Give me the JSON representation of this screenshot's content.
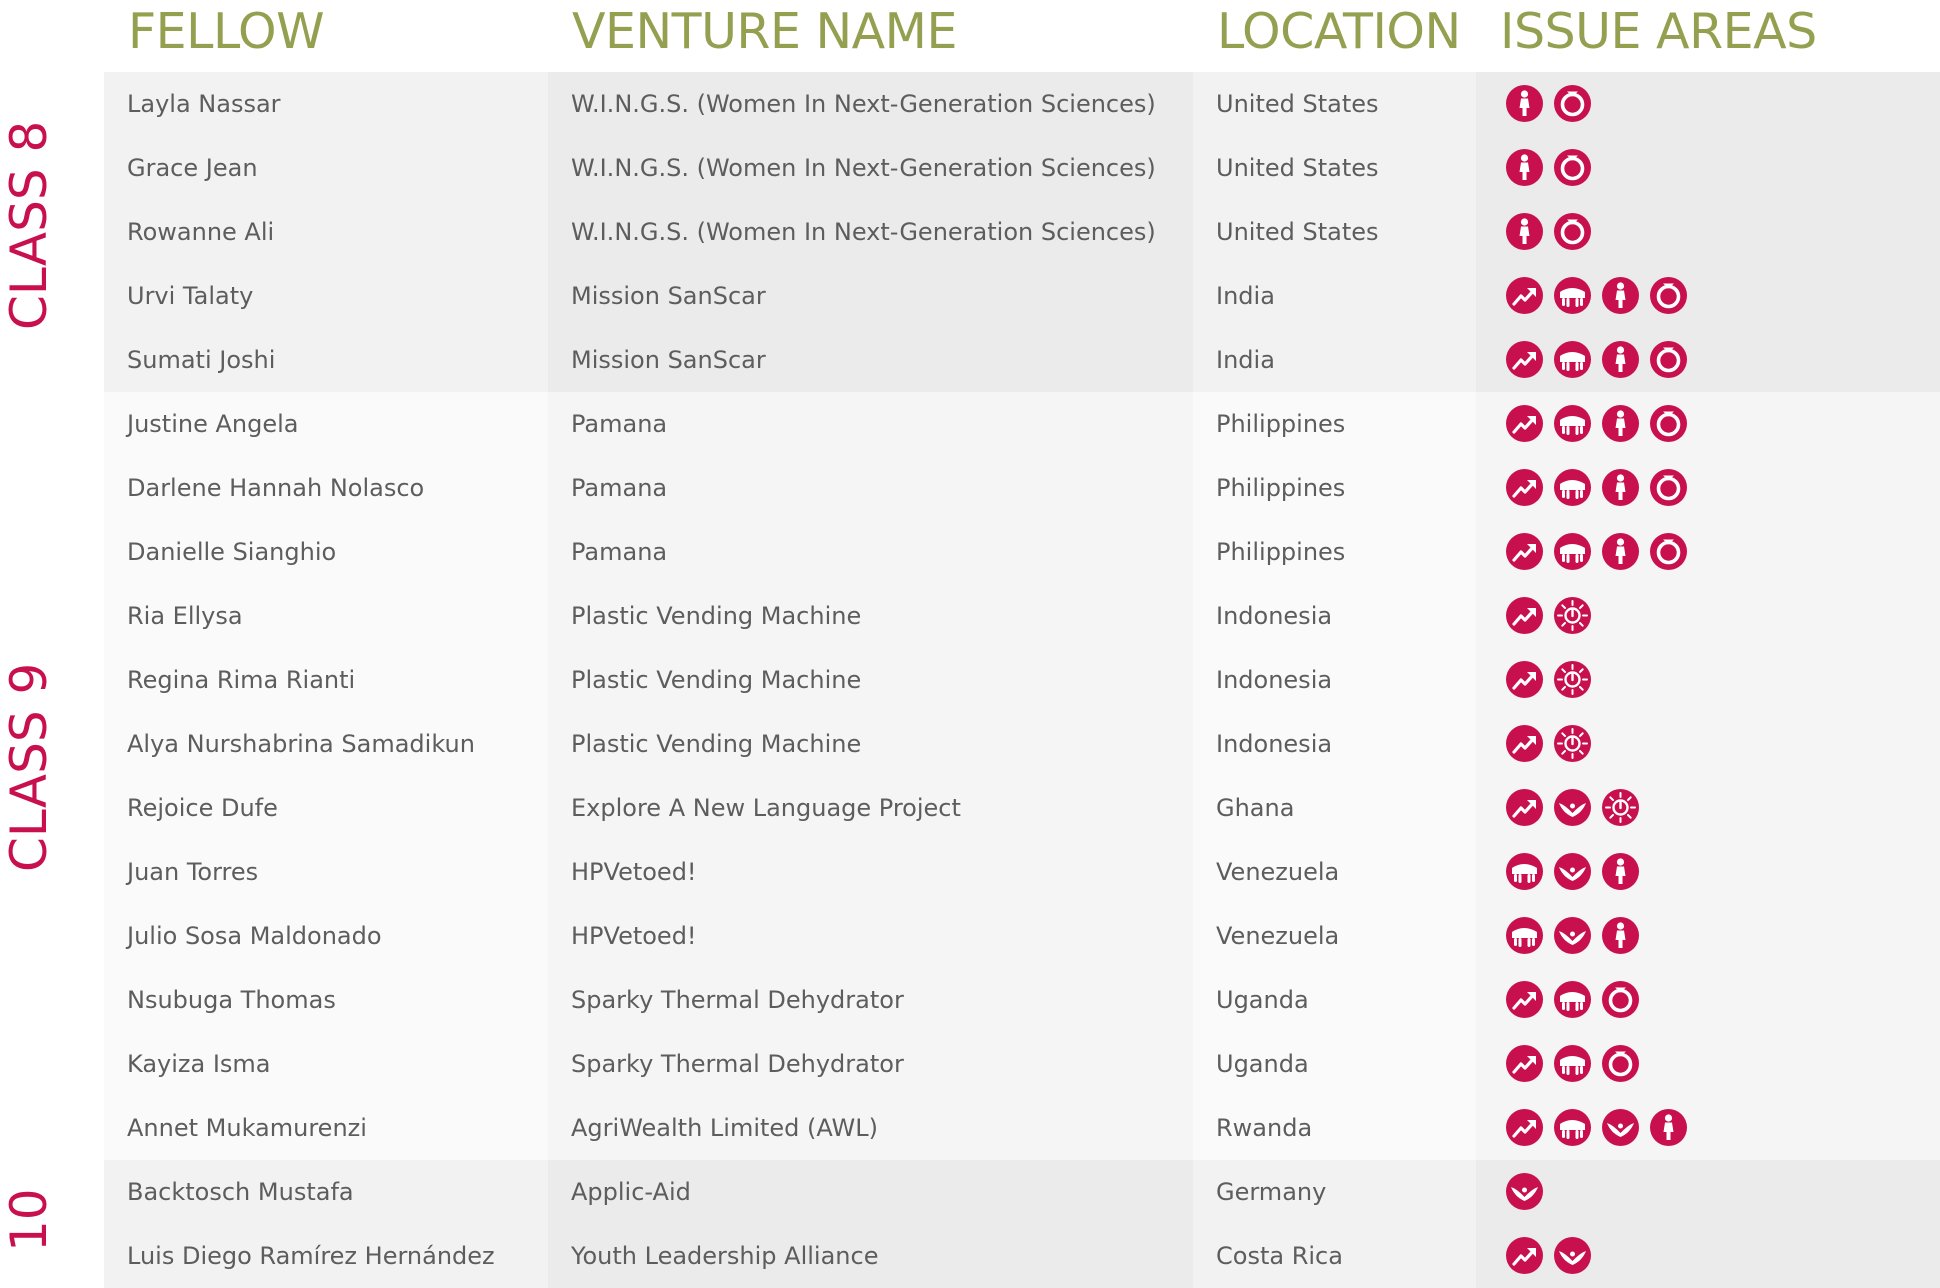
{
  "headers": {
    "fellow": "FELLOW",
    "venture": "VENTURE NAME",
    "location": "LOCATION",
    "issues": "ISSUE AREAS"
  },
  "class_labels": {
    "class8": "CLASS 8",
    "class9": "CLASS 9",
    "class10": "10"
  },
  "colors": {
    "header_text": "#94a04f",
    "class_label": "#c8104e",
    "icon_fill": "#c8104e",
    "row_text": "#5d5d5d"
  },
  "rows": [
    {
      "fellow": "Layla Nassar",
      "venture": "W.I.N.G.S. (Women In Next-Generation Sciences)",
      "location": "United States",
      "issues": [
        "woman-icon",
        "ring-icon"
      ],
      "group": "class8"
    },
    {
      "fellow": "Grace Jean",
      "venture": "W.I.N.G.S. (Women In Next-Generation Sciences)",
      "location": "United States",
      "issues": [
        "woman-icon",
        "ring-icon"
      ],
      "group": "class8"
    },
    {
      "fellow": "Rowanne Ali",
      "venture": "W.I.N.G.S. (Women In Next-Generation Sciences)",
      "location": "United States",
      "issues": [
        "woman-icon",
        "ring-icon"
      ],
      "group": "class8"
    },
    {
      "fellow": "Urvi Talaty",
      "venture": "Mission SanScar",
      "location": "India",
      "issues": [
        "growth-icon",
        "hands-icon",
        "woman-icon",
        "ring-icon"
      ],
      "group": "class8"
    },
    {
      "fellow": "Sumati Joshi",
      "venture": "Mission SanScar",
      "location": "India",
      "issues": [
        "growth-icon",
        "hands-icon",
        "woman-icon",
        "ring-icon"
      ],
      "group": "class8"
    },
    {
      "fellow": "Justine Angela",
      "venture": "Pamana",
      "location": "Philippines",
      "issues": [
        "growth-icon",
        "hands-icon",
        "woman-icon",
        "ring-icon"
      ],
      "group": "class9"
    },
    {
      "fellow": "Darlene Hannah Nolasco",
      "venture": "Pamana",
      "location": "Philippines",
      "issues": [
        "growth-icon",
        "hands-icon",
        "woman-icon",
        "ring-icon"
      ],
      "group": "class9"
    },
    {
      "fellow": "Danielle Sianghio",
      "venture": "Pamana",
      "location": "Philippines",
      "issues": [
        "growth-icon",
        "hands-icon",
        "woman-icon",
        "ring-icon"
      ],
      "group": "class9"
    },
    {
      "fellow": "Ria Ellysa",
      "venture": "Plastic Vending Machine",
      "location": "Indonesia",
      "issues": [
        "growth-icon",
        "sun-power-icon"
      ],
      "group": "class9"
    },
    {
      "fellow": "Regina Rima Rianti",
      "venture": "Plastic Vending Machine",
      "location": "Indonesia",
      "issues": [
        "growth-icon",
        "sun-power-icon"
      ],
      "group": "class9"
    },
    {
      "fellow": "Alya Nurshabrina Samadikun",
      "venture": "Plastic Vending Machine",
      "location": "Indonesia",
      "issues": [
        "growth-icon",
        "sun-power-icon"
      ],
      "group": "class9"
    },
    {
      "fellow": "Rejoice Dufe",
      "venture": "Explore A New Language Project",
      "location": "Ghana",
      "issues": [
        "growth-icon",
        "wings-icon",
        "sun-power-icon"
      ],
      "group": "class9"
    },
    {
      "fellow": "Juan Torres",
      "venture": "HPVetoed!",
      "location": "Venezuela",
      "issues": [
        "hands-icon",
        "wings-icon",
        "woman-icon"
      ],
      "group": "class9"
    },
    {
      "fellow": "Julio Sosa Maldonado",
      "venture": "HPVetoed!",
      "location": "Venezuela",
      "issues": [
        "hands-icon",
        "wings-icon",
        "woman-icon"
      ],
      "group": "class9"
    },
    {
      "fellow": "Nsubuga Thomas",
      "venture": "Sparky Thermal Dehydrator",
      "location": "Uganda",
      "issues": [
        "growth-icon",
        "hands-icon",
        "ring-icon"
      ],
      "group": "class9"
    },
    {
      "fellow": "Kayiza Isma",
      "venture": "Sparky Thermal Dehydrator",
      "location": "Uganda",
      "issues": [
        "growth-icon",
        "hands-icon",
        "ring-icon"
      ],
      "group": "class9"
    },
    {
      "fellow": "Annet Mukamurenzi",
      "venture": "AgriWealth Limited (AWL)",
      "location": "Rwanda",
      "issues": [
        "growth-icon",
        "hands-icon",
        "wings-icon",
        "woman-icon"
      ],
      "group": "class9"
    },
    {
      "fellow": "Backtosch Mustafa",
      "venture": "Applic-Aid",
      "location": "Germany",
      "issues": [
        "wings-icon"
      ],
      "group": "class10"
    },
    {
      "fellow": "Luis Diego Ramírez Hernández",
      "venture": "Youth Leadership Alliance",
      "location": "Costa Rica",
      "issues": [
        "growth-icon",
        "wings-icon"
      ],
      "group": "class10"
    }
  ]
}
